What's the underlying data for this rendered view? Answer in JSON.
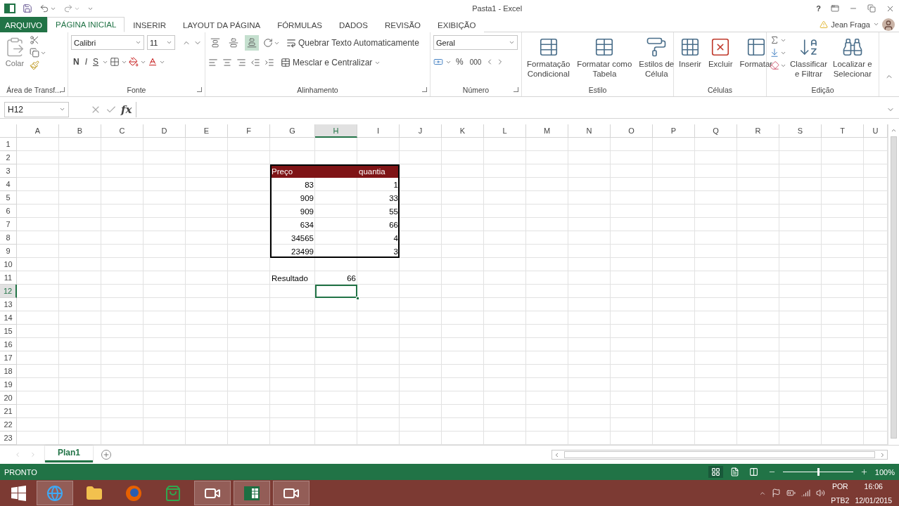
{
  "title_bar": {
    "title": "Pasta1 - Excel",
    "help": "?"
  },
  "ribbon_tabs": [
    {
      "label": "ARQUIVO",
      "kind": "file",
      "selected": false
    },
    {
      "label": "PÁGINA INICIAL",
      "kind": "tab",
      "selected": true
    },
    {
      "label": "INSERIR",
      "kind": "tab",
      "selected": false
    },
    {
      "label": "LAYOUT DA PÁGINA",
      "kind": "tab",
      "selected": false
    },
    {
      "label": "FÓRMULAS",
      "kind": "tab",
      "selected": false
    },
    {
      "label": "DADOS",
      "kind": "tab",
      "selected": false
    },
    {
      "label": "REVISÃO",
      "kind": "tab",
      "selected": false
    },
    {
      "label": "EXIBIÇÃO",
      "kind": "tab",
      "selected": false
    }
  ],
  "user": {
    "name": "Jean Fraga"
  },
  "ribbon": {
    "clipboard": {
      "label": "Área de Transf...",
      "paste": "Colar"
    },
    "font": {
      "label": "Fonte",
      "name": "Calibri",
      "size": "11",
      "bold": "N",
      "italic": "I",
      "underline": "S"
    },
    "alignment": {
      "label": "Alinhamento",
      "vertical": [
        {
          "selected": false
        },
        {
          "selected": false
        },
        {
          "selected": true
        }
      ],
      "wrap": "Quebrar Texto Automaticamente",
      "merge": "Mesclar e Centralizar"
    },
    "number": {
      "label": "Número",
      "format": "Geral",
      "percent": "%",
      "thousands": "000"
    },
    "styles": {
      "label": "Estilo",
      "buttons": [
        {
          "kind": "conditional",
          "lines": [
            "Formatação",
            "Condicional"
          ]
        },
        {
          "kind": "table",
          "lines": [
            "Formatar como",
            "Tabela"
          ]
        },
        {
          "kind": "cellstyle",
          "lines": [
            "Estilos de",
            "Célula"
          ]
        }
      ]
    },
    "cells": {
      "label": "Células",
      "buttons": [
        {
          "kind": "insert",
          "lines": [
            "Inserir"
          ]
        },
        {
          "kind": "delete",
          "lines": [
            "Excluir"
          ]
        },
        {
          "kind": "format",
          "lines": [
            "Formatar"
          ]
        }
      ]
    },
    "editing": {
      "label": "Edição",
      "buttons": [
        {
          "kind": "sort",
          "lines": [
            "Classificar",
            "e Filtrar"
          ]
        },
        {
          "kind": "find",
          "lines": [
            "Localizar e",
            "Selecionar"
          ]
        }
      ]
    }
  },
  "formula_bar": {
    "name_box": "H12",
    "function_label": "fx"
  },
  "sheet": {
    "columns": [
      {
        "label": "A",
        "selected": false
      },
      {
        "label": "B",
        "selected": false
      },
      {
        "label": "C",
        "selected": false
      },
      {
        "label": "D",
        "selected": false
      },
      {
        "label": "E",
        "selected": false
      },
      {
        "label": "F",
        "selected": false
      },
      {
        "label": "G",
        "selected": false
      },
      {
        "label": "H",
        "selected": true
      },
      {
        "label": "I",
        "selected": false
      },
      {
        "label": "J",
        "selected": false
      },
      {
        "label": "K",
        "selected": false
      },
      {
        "label": "L",
        "selected": false
      },
      {
        "label": "M",
        "selected": false
      },
      {
        "label": "N",
        "selected": false
      },
      {
        "label": "O",
        "selected": false
      },
      {
        "label": "P",
        "selected": false
      },
      {
        "label": "Q",
        "selected": false
      },
      {
        "label": "R",
        "selected": false
      },
      {
        "label": "S",
        "selected": false
      },
      {
        "label": "T",
        "selected": false
      },
      {
        "label": "U",
        "selected": false
      }
    ],
    "rows": [
      {
        "label": "1",
        "selected": false
      },
      {
        "label": "2",
        "selected": false
      },
      {
        "label": "3",
        "selected": false
      },
      {
        "label": "4",
        "selected": false
      },
      {
        "label": "5",
        "selected": false
      },
      {
        "label": "6",
        "selected": false
      },
      {
        "label": "7",
        "selected": false
      },
      {
        "label": "8",
        "selected": false
      },
      {
        "label": "9",
        "selected": false
      },
      {
        "label": "10",
        "selected": false
      },
      {
        "label": "11",
        "selected": false
      },
      {
        "label": "12",
        "selected": true
      },
      {
        "label": "13",
        "selected": false
      },
      {
        "label": "14",
        "selected": false
      },
      {
        "label": "15",
        "selected": false
      },
      {
        "label": "16",
        "selected": false
      },
      {
        "label": "17",
        "selected": false
      },
      {
        "label": "18",
        "selected": false
      },
      {
        "label": "19",
        "selected": false
      },
      {
        "label": "20",
        "selected": false
      },
      {
        "label": "21",
        "selected": false
      },
      {
        "label": "22",
        "selected": false
      },
      {
        "label": "23",
        "selected": false
      }
    ],
    "table": {
      "header": {
        "column_1": "Preço",
        "column_3": "quantia"
      },
      "rows": [
        {
          "column_1": "83",
          "column_3": "1"
        },
        {
          "column_1": "909",
          "column_3": "33"
        },
        {
          "column_1": "909",
          "column_3": "55"
        },
        {
          "column_1": "634",
          "column_3": "66"
        },
        {
          "column_1": "34565",
          "column_3": "4"
        },
        {
          "column_1": "23499",
          "column_3": "3"
        }
      ]
    },
    "result": {
      "label": "Resultado",
      "value": "66"
    }
  },
  "sheet_tabs": [
    {
      "label": "Plan1",
      "selected": true
    }
  ],
  "status_bar": {
    "status": "PRONTO",
    "views": [
      {
        "kind": "normal",
        "selected": true
      },
      {
        "kind": "layout",
        "selected": false
      },
      {
        "kind": "pagebreak",
        "selected": false
      }
    ],
    "zoom": {
      "level": 0.5,
      "reading": "100%"
    }
  },
  "taskbar": {
    "apps": [
      {
        "kind": "ie",
        "open": true
      },
      {
        "kind": "explorer",
        "open": false
      },
      {
        "kind": "firefox",
        "open": false
      },
      {
        "kind": "store",
        "open": false
      },
      {
        "kind": "camtasia",
        "open": true
      },
      {
        "kind": "excel",
        "open": true
      },
      {
        "kind": "camtasia",
        "open": true
      }
    ],
    "language": "POR",
    "layout": "PTB2",
    "time": "16:06",
    "date": "12/01/2015"
  }
}
